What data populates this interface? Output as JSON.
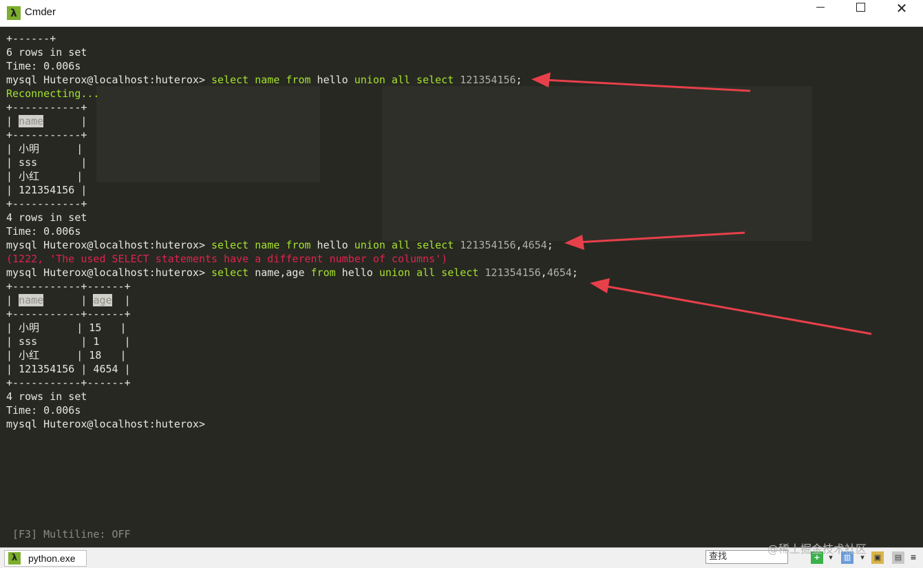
{
  "window": {
    "title": "Cmder",
    "app_icon": "λ",
    "minimize": "—",
    "close": "✕"
  },
  "terminal": {
    "lines": [
      {
        "segments": [
          {
            "t": "+------+",
            "c": ""
          }
        ]
      },
      {
        "segments": [
          {
            "t": "6 rows in set",
            "c": ""
          }
        ]
      },
      {
        "segments": [
          {
            "t": "Time: 0.006s",
            "c": ""
          }
        ]
      },
      {
        "segments": [
          {
            "t": "mysql Huterox@localhost:huterox> ",
            "c": ""
          },
          {
            "t": "select",
            "c": "kw"
          },
          {
            "t": " ",
            "c": ""
          },
          {
            "t": "name",
            "c": "kw"
          },
          {
            "t": " ",
            "c": ""
          },
          {
            "t": "from",
            "c": "kw"
          },
          {
            "t": " hello ",
            "c": ""
          },
          {
            "t": "union",
            "c": "kw"
          },
          {
            "t": " ",
            "c": ""
          },
          {
            "t": "all",
            "c": "kw"
          },
          {
            "t": " ",
            "c": ""
          },
          {
            "t": "select",
            "c": "kw"
          },
          {
            "t": " ",
            "c": ""
          },
          {
            "t": "121354156",
            "c": "num"
          },
          {
            "t": ";",
            "c": ""
          }
        ]
      },
      {
        "segments": [
          {
            "t": "Reconnecting...",
            "c": "green"
          }
        ]
      },
      {
        "segments": [
          {
            "t": "+-----------+",
            "c": ""
          }
        ]
      },
      {
        "segments": [
          {
            "t": "| ",
            "c": ""
          },
          {
            "t": "name",
            "c": "hl"
          },
          {
            "t": "      |",
            "c": ""
          }
        ]
      },
      {
        "segments": [
          {
            "t": "+-----------+",
            "c": ""
          }
        ]
      },
      {
        "segments": [
          {
            "t": "| 小明      |",
            "c": ""
          }
        ]
      },
      {
        "segments": [
          {
            "t": "| sss       |",
            "c": ""
          }
        ]
      },
      {
        "segments": [
          {
            "t": "| 小红      |",
            "c": ""
          }
        ]
      },
      {
        "segments": [
          {
            "t": "| 121354156 |",
            "c": ""
          }
        ]
      },
      {
        "segments": [
          {
            "t": "+-----------+",
            "c": ""
          }
        ]
      },
      {
        "segments": [
          {
            "t": "4 rows in set",
            "c": ""
          }
        ]
      },
      {
        "segments": [
          {
            "t": "Time: 0.006s",
            "c": ""
          }
        ]
      },
      {
        "segments": [
          {
            "t": "mysql Huterox@localhost:huterox> ",
            "c": ""
          },
          {
            "t": "select",
            "c": "kw"
          },
          {
            "t": " ",
            "c": ""
          },
          {
            "t": "name",
            "c": "kw"
          },
          {
            "t": " ",
            "c": ""
          },
          {
            "t": "from",
            "c": "kw"
          },
          {
            "t": " hello ",
            "c": ""
          },
          {
            "t": "union",
            "c": "kw"
          },
          {
            "t": " ",
            "c": ""
          },
          {
            "t": "all",
            "c": "kw"
          },
          {
            "t": " ",
            "c": ""
          },
          {
            "t": "select",
            "c": "kw"
          },
          {
            "t": " ",
            "c": ""
          },
          {
            "t": "121354156",
            "c": "num"
          },
          {
            "t": ",",
            "c": ""
          },
          {
            "t": "4654",
            "c": "num"
          },
          {
            "t": ";",
            "c": ""
          }
        ]
      },
      {
        "segments": [
          {
            "t": "(1222, 'The used SELECT statements have a different number of columns')",
            "c": "red"
          }
        ]
      },
      {
        "segments": [
          {
            "t": "mysql Huterox@localhost:huterox> ",
            "c": ""
          },
          {
            "t": "select",
            "c": "kw"
          },
          {
            "t": " name,age ",
            "c": ""
          },
          {
            "t": "from",
            "c": "kw"
          },
          {
            "t": " hello ",
            "c": ""
          },
          {
            "t": "union",
            "c": "kw"
          },
          {
            "t": " ",
            "c": ""
          },
          {
            "t": "all",
            "c": "kw"
          },
          {
            "t": " ",
            "c": ""
          },
          {
            "t": "select",
            "c": "kw"
          },
          {
            "t": " ",
            "c": ""
          },
          {
            "t": "121354156",
            "c": "num"
          },
          {
            "t": ",",
            "c": ""
          },
          {
            "t": "4654",
            "c": "num"
          },
          {
            "t": ";",
            "c": ""
          }
        ]
      },
      {
        "segments": [
          {
            "t": "+-----------+------+",
            "c": ""
          }
        ]
      },
      {
        "segments": [
          {
            "t": "| ",
            "c": ""
          },
          {
            "t": "name",
            "c": "hl"
          },
          {
            "t": "      | ",
            "c": ""
          },
          {
            "t": "age",
            "c": "hl"
          },
          {
            "t": "  |",
            "c": ""
          }
        ]
      },
      {
        "segments": [
          {
            "t": "+-----------+------+",
            "c": ""
          }
        ]
      },
      {
        "segments": [
          {
            "t": "| 小明      | 15   |",
            "c": ""
          }
        ]
      },
      {
        "segments": [
          {
            "t": "| sss       | 1    |",
            "c": ""
          }
        ]
      },
      {
        "segments": [
          {
            "t": "| 小红      | 18   |",
            "c": ""
          }
        ]
      },
      {
        "segments": [
          {
            "t": "| 121354156 | 4654 |",
            "c": ""
          }
        ]
      },
      {
        "segments": [
          {
            "t": "+-----------+------+",
            "c": ""
          }
        ]
      },
      {
        "segments": [
          {
            "t": "4 rows in set",
            "c": ""
          }
        ]
      },
      {
        "segments": [
          {
            "t": "Time: 0.006s",
            "c": ""
          }
        ]
      },
      {
        "segments": [
          {
            "t": "mysql Huterox@localhost:huterox>",
            "c": ""
          }
        ]
      }
    ],
    "multiline_hint": "[F3] Multiline: OFF"
  },
  "statusbar": {
    "tab_label": "python.exe",
    "tab_icon": "λ",
    "search_placeholder": "查找",
    "watermark": "@稀土掘金技术社区"
  },
  "colors": {
    "background": "#272822",
    "keyword": "#a6e22e",
    "error": "#e0234e",
    "arrow": "#e8404a",
    "cmder_green": "#7cae2f"
  }
}
